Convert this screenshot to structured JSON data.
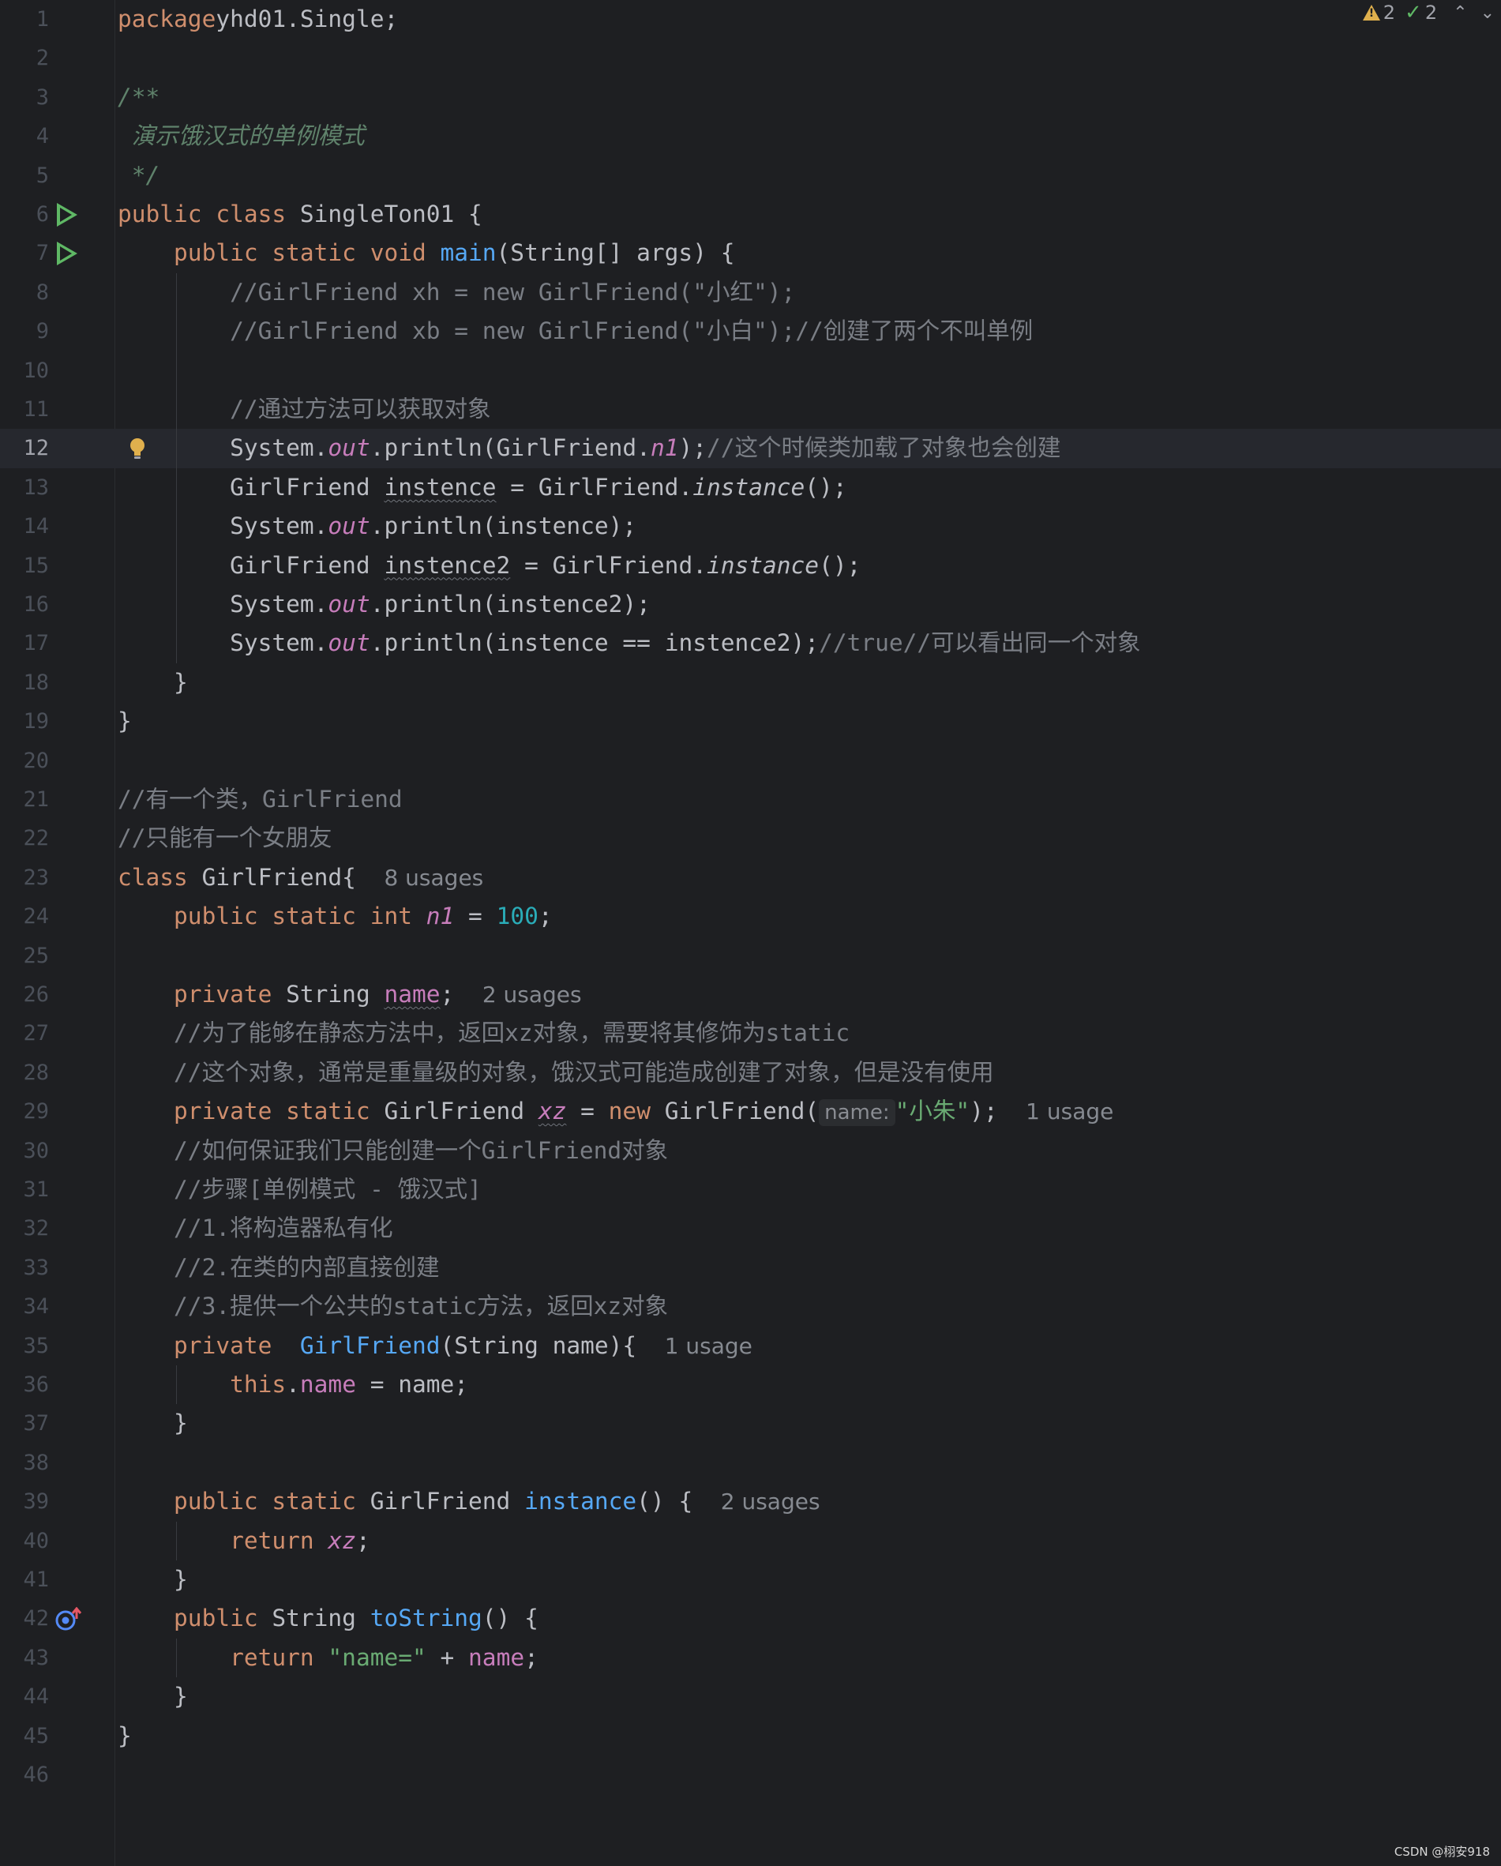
{
  "editor": {
    "inspections": {
      "warnings": "2",
      "ok": "2"
    },
    "lines": [
      {
        "n": "1",
        "t": [
          [
            "kw",
            "package"
          ],
          [
            "",
            "yhd01.Single;"
          ]
        ]
      },
      {
        "n": "2",
        "t": []
      },
      {
        "n": "3",
        "t": [
          [
            "doc",
            "/**"
          ]
        ]
      },
      {
        "n": "4",
        "t": [
          [
            "doc",
            " 演示饿汉式的单例模式"
          ]
        ]
      },
      {
        "n": "5",
        "t": [
          [
            "doc",
            " */"
          ]
        ]
      },
      {
        "n": "6",
        "t": [
          [
            "kw",
            "public class "
          ],
          [
            "",
            "SingleTon01 {"
          ]
        ]
      },
      {
        "n": "7",
        "t": [
          [
            "",
            "    "
          ],
          [
            "kw",
            "public static void "
          ],
          [
            "fn",
            "main"
          ],
          [
            "",
            "(String[] args) {"
          ]
        ]
      },
      {
        "n": "8",
        "t": [
          [
            "",
            "        "
          ],
          [
            "cmt",
            "//GirlFriend xh = new GirlFriend(\"小红\");"
          ]
        ]
      },
      {
        "n": "9",
        "t": [
          [
            "",
            "        "
          ],
          [
            "cmt",
            "//GirlFriend xb = new GirlFriend(\"小白\");//创建了两个不叫单例"
          ]
        ]
      },
      {
        "n": "10",
        "t": []
      },
      {
        "n": "11",
        "t": [
          [
            "",
            "        "
          ],
          [
            "cmt",
            "//通过方法可以获取对象"
          ]
        ]
      },
      {
        "n": "12",
        "t": [
          [
            "",
            "        System."
          ],
          [
            "st",
            "out"
          ],
          [
            "",
            ".println(GirlFriend."
          ],
          [
            "st",
            "n1"
          ],
          [
            "",
            ");"
          ],
          [
            "cmt",
            "//这个时候类加载了对象也会创建"
          ]
        ]
      },
      {
        "n": "13",
        "t": [
          [
            "",
            "        GirlFriend "
          ],
          [
            "wavy",
            "instence"
          ],
          [
            "",
            " = GirlFriend."
          ],
          [
            "it",
            "instance"
          ],
          [
            "",
            "();"
          ]
        ]
      },
      {
        "n": "14",
        "t": [
          [
            "",
            "        System."
          ],
          [
            "st",
            "out"
          ],
          [
            "",
            ".println(instence);"
          ]
        ]
      },
      {
        "n": "15",
        "t": [
          [
            "",
            "        GirlFriend "
          ],
          [
            "wavy",
            "instence2"
          ],
          [
            "",
            " = GirlFriend."
          ],
          [
            "it",
            "instance"
          ],
          [
            "",
            "();"
          ]
        ]
      },
      {
        "n": "16",
        "t": [
          [
            "",
            "        System."
          ],
          [
            "st",
            "out"
          ],
          [
            "",
            ".println(instence2);"
          ]
        ]
      },
      {
        "n": "17",
        "t": [
          [
            "",
            "        System."
          ],
          [
            "st",
            "out"
          ],
          [
            "",
            ".println(instence == instence2);"
          ],
          [
            "cmt",
            "//true//可以看出同一个对象"
          ]
        ]
      },
      {
        "n": "18",
        "t": [
          [
            "",
            "    }"
          ]
        ]
      },
      {
        "n": "19",
        "t": [
          [
            "",
            "}"
          ]
        ]
      },
      {
        "n": "20",
        "t": []
      },
      {
        "n": "21",
        "t": [
          [
            "cmt",
            "//有一个类，GirlFriend"
          ]
        ]
      },
      {
        "n": "22",
        "t": [
          [
            "cmt",
            "//只能有一个女朋友"
          ]
        ]
      },
      {
        "n": "23",
        "t": [
          [
            "kw",
            "class "
          ],
          [
            "",
            "GirlFriend{  "
          ],
          [
            "hint",
            "8 usages"
          ]
        ]
      },
      {
        "n": "24",
        "t": [
          [
            "",
            "    "
          ],
          [
            "kw",
            "public static int "
          ],
          [
            "st",
            "n1"
          ],
          [
            "",
            " = "
          ],
          [
            "num",
            "100"
          ],
          [
            "",
            ";"
          ]
        ]
      },
      {
        "n": "25",
        "t": []
      },
      {
        "n": "26",
        "t": [
          [
            "",
            "    "
          ],
          [
            "kw",
            "private "
          ],
          [
            "",
            "String "
          ],
          [
            "fldw",
            "name"
          ],
          [
            "",
            ";  "
          ],
          [
            "hint",
            "2 usages"
          ]
        ]
      },
      {
        "n": "27",
        "t": [
          [
            "",
            "    "
          ],
          [
            "cmt",
            "//为了能够在静态方法中，返回xz对象，需要将其修饰为static"
          ]
        ]
      },
      {
        "n": "28",
        "t": [
          [
            "",
            "    "
          ],
          [
            "cmt",
            "//这个对象，通常是重量级的对象，饿汉式可能造成创建了对象，但是没有使用"
          ]
        ]
      },
      {
        "n": "29",
        "t": [
          [
            "",
            "    "
          ],
          [
            "kw",
            "private static "
          ],
          [
            "",
            "GirlFriend "
          ],
          [
            "stw",
            "xz"
          ],
          [
            "",
            " = "
          ],
          [
            "kw",
            "new "
          ],
          [
            "",
            "GirlFriend("
          ],
          [
            "inlay",
            "name:"
          ],
          [
            "str",
            "\"小朱\""
          ],
          [
            "",
            ");  "
          ],
          [
            "hint",
            "1 usage"
          ]
        ]
      },
      {
        "n": "30",
        "t": [
          [
            "",
            "    "
          ],
          [
            "cmt",
            "//如何保证我们只能创建一个GirlFriend对象"
          ]
        ]
      },
      {
        "n": "31",
        "t": [
          [
            "",
            "    "
          ],
          [
            "cmt",
            "//步骤[单例模式 - 饿汉式]"
          ]
        ]
      },
      {
        "n": "32",
        "t": [
          [
            "",
            "    "
          ],
          [
            "cmt",
            "//1.将构造器私有化"
          ]
        ]
      },
      {
        "n": "33",
        "t": [
          [
            "",
            "    "
          ],
          [
            "cmt",
            "//2.在类的内部直接创建"
          ]
        ]
      },
      {
        "n": "34",
        "t": [
          [
            "",
            "    "
          ],
          [
            "cmt",
            "//3.提供一个公共的static方法，返回xz对象"
          ]
        ]
      },
      {
        "n": "35",
        "t": [
          [
            "",
            "    "
          ],
          [
            "kw",
            "private  "
          ],
          [
            "fn",
            "GirlFriend"
          ],
          [
            "",
            "(String name){  "
          ],
          [
            "hint",
            "1 usage"
          ]
        ]
      },
      {
        "n": "36",
        "t": [
          [
            "",
            "        "
          ],
          [
            "kw",
            "this"
          ],
          [
            "",
            "."
          ],
          [
            "fld",
            "name"
          ],
          [
            "",
            " = name;"
          ]
        ]
      },
      {
        "n": "37",
        "t": [
          [
            "",
            "    }"
          ]
        ]
      },
      {
        "n": "38",
        "t": []
      },
      {
        "n": "39",
        "t": [
          [
            "",
            "    "
          ],
          [
            "kw",
            "public static "
          ],
          [
            "",
            "GirlFriend "
          ],
          [
            "fn",
            "instance"
          ],
          [
            "",
            "() {  "
          ],
          [
            "hint",
            "2 usages"
          ]
        ]
      },
      {
        "n": "40",
        "t": [
          [
            "",
            "        "
          ],
          [
            "kw",
            "return "
          ],
          [
            "st",
            "xz"
          ],
          [
            "",
            ";"
          ]
        ]
      },
      {
        "n": "41",
        "t": [
          [
            "",
            "    }"
          ]
        ]
      },
      {
        "n": "42",
        "t": [
          [
            "",
            "    "
          ],
          [
            "kw",
            "public "
          ],
          [
            "",
            "String "
          ],
          [
            "fn",
            "toString"
          ],
          [
            "",
            "() {"
          ]
        ]
      },
      {
        "n": "43",
        "t": [
          [
            "",
            "        "
          ],
          [
            "kw",
            "return "
          ],
          [
            "str",
            "\"name=\""
          ],
          [
            "",
            " + "
          ],
          [
            "fld",
            "name"
          ],
          [
            "",
            ";"
          ]
        ]
      },
      {
        "n": "44",
        "t": [
          [
            "",
            "    }"
          ]
        ]
      },
      {
        "n": "45",
        "t": [
          [
            "",
            "}"
          ]
        ]
      },
      {
        "n": "46",
        "t": []
      }
    ],
    "current_line": "12"
  },
  "watermark": "CSDN @栩安918"
}
